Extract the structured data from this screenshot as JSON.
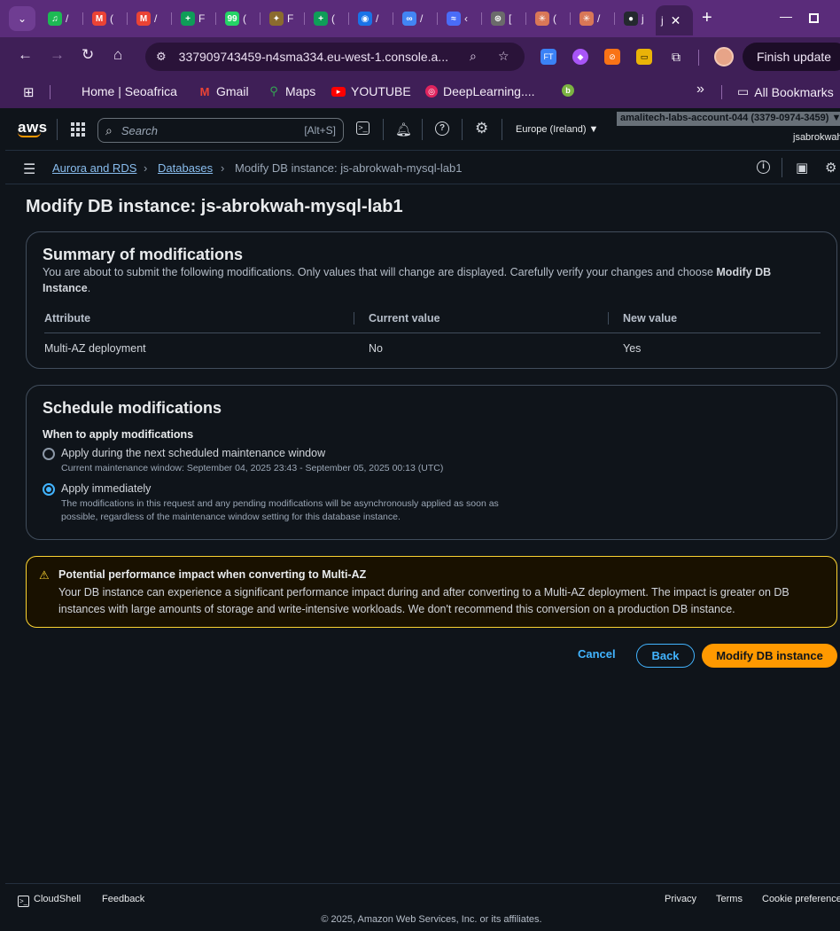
{
  "browser": {
    "tabs": [
      {
        "icon": "spotify-icon",
        "label": "/",
        "color": "#1db954",
        "glyph": "♫"
      },
      {
        "icon": "gmail-icon",
        "label": "(",
        "color": "#ea4335",
        "glyph": "M"
      },
      {
        "icon": "gmail-icon",
        "label": "/",
        "color": "#ea4335",
        "glyph": "M"
      },
      {
        "icon": "sheets-icon",
        "label": "F",
        "color": "#0f9d58",
        "glyph": "+"
      },
      {
        "icon": "whatsapp-icon",
        "label": "(",
        "color": "#25d366",
        "glyph": "99"
      },
      {
        "icon": "crest-icon",
        "label": "F",
        "color": "#8b6b2e",
        "glyph": "✦"
      },
      {
        "icon": "sheets-icon",
        "label": "(",
        "color": "#0f9d58",
        "glyph": "+"
      },
      {
        "icon": "eye-icon",
        "label": "/",
        "color": "#1a73e8",
        "glyph": "◉"
      },
      {
        "icon": "infinity-icon",
        "label": "/",
        "color": "#4285f4",
        "glyph": "∞"
      },
      {
        "icon": "gemini-icon",
        "label": "‹",
        "color": "#4a6cf7",
        "glyph": "≈"
      },
      {
        "icon": "openai-icon",
        "label": "[",
        "color": "#6b6b6b",
        "glyph": "⊛"
      },
      {
        "icon": "claude-icon",
        "label": "(",
        "color": "#d97757",
        "glyph": "✳"
      },
      {
        "icon": "claude-icon",
        "label": "/",
        "color": "#d97757",
        "glyph": "✳"
      },
      {
        "icon": "github-icon",
        "label": "j",
        "color": "#24292f",
        "glyph": "●"
      }
    ],
    "active_tab_label": "j",
    "url": "337909743459-n4sma334.eu-west-1.console.a...",
    "finish_update": "Finish update",
    "bookmarks": {
      "home": "Home | Seoafrica",
      "gmail": "Gmail",
      "maps": "Maps",
      "youtube": "YOUTUBE",
      "deeplearning": "DeepLearning....",
      "more": "»",
      "all": "All Bookmarks"
    }
  },
  "aws": {
    "logo": "aws",
    "search_placeholder": "Search",
    "search_shortcut": "[Alt+S]",
    "region": "Europe (Ireland) ▼",
    "account": "amalitech-labs-account-044 (3379-0974-3459) ▼",
    "username": "jsabrokwah"
  },
  "breadcrumb": {
    "item1": "Aurora and RDS",
    "item2": "Databases",
    "current": "Modify DB instance: js-abrokwah-mysql-lab1"
  },
  "page_title": "Modify DB instance: js-abrokwah-mysql-lab1",
  "summary": {
    "title": "Summary of modifications",
    "description_pre": "You are about to submit the following modifications. Only values that will change are displayed. Carefully verify your changes and choose ",
    "description_bold1": "Modify DB",
    "description_bold2": "Instance",
    "description_post": ".",
    "columns": [
      "Attribute",
      "Current value",
      "New value"
    ],
    "rows": [
      {
        "attribute": "Multi-AZ deployment",
        "current": "No",
        "new": "Yes"
      }
    ]
  },
  "schedule": {
    "title": "Schedule modifications",
    "when_label": "When to apply modifications",
    "option1_label": "Apply during the next scheduled maintenance window",
    "option1_desc": "Current maintenance window: September 04, 2025 23:43 - September 05, 2025 00:13 (UTC)",
    "option2_label": "Apply immediately",
    "option2_desc_line1": "The modifications in this request and any pending modifications will be asynchronously applied as soon as",
    "option2_desc_line2": "possible, regardless of the maintenance window setting for this database instance.",
    "selected": "immediately"
  },
  "alert": {
    "title": "Potential performance impact when converting to Multi-AZ",
    "body": "Your DB instance can experience a significant performance impact during and after converting to a Multi-AZ deployment. The impact is greater on DB instances with large amounts of storage and write-intensive workloads. We don't recommend this conversion on a production DB instance."
  },
  "actions": {
    "cancel": "Cancel",
    "back": "Back",
    "submit": "Modify DB instance"
  },
  "footer": {
    "cloudshell": "CloudShell",
    "feedback": "Feedback",
    "privacy": "Privacy",
    "terms": "Terms",
    "cookies": "Cookie preferences",
    "copyright": "© 2025, Amazon Web Services, Inc. or its affiliates."
  },
  "colors": {
    "accent": "#42b4ff",
    "primary_button": "#ff9900",
    "warning": "#fbd332",
    "browser_frame": "#5a2c7a"
  }
}
